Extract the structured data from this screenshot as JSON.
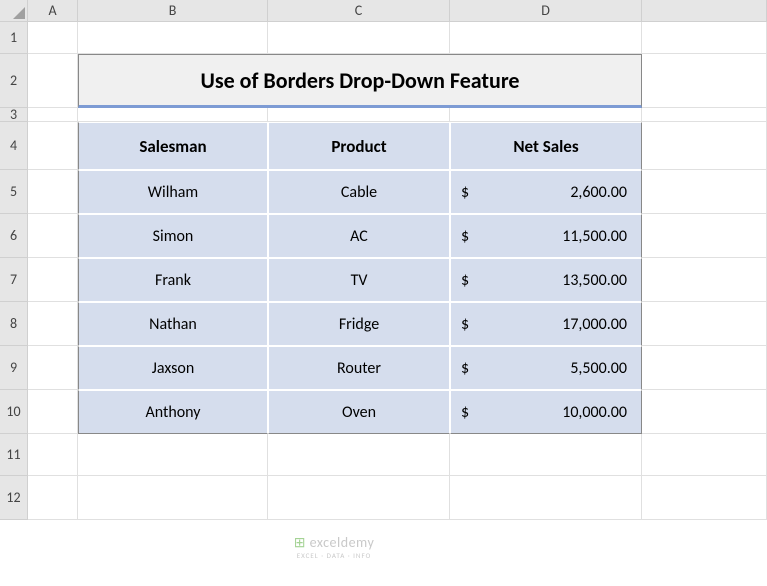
{
  "columns": [
    "A",
    "B",
    "C",
    "D",
    ""
  ],
  "rows": [
    "1",
    "2",
    "3",
    "4",
    "5",
    "6",
    "7",
    "8",
    "9",
    "10",
    "11",
    "12"
  ],
  "title": "Use of Borders Drop-Down Feature",
  "headers": {
    "salesman": "Salesman",
    "product": "Product",
    "netsales": "Net Sales"
  },
  "currency": "$",
  "data": [
    {
      "salesman": "Wilham",
      "product": "Cable",
      "netsales": "2,600.00"
    },
    {
      "salesman": "Simon",
      "product": "AC",
      "netsales": "11,500.00"
    },
    {
      "salesman": "Frank",
      "product": "TV",
      "netsales": "13,500.00"
    },
    {
      "salesman": "Nathan",
      "product": "Fridge",
      "netsales": "17,000.00"
    },
    {
      "salesman": "Jaxson",
      "product": "Router",
      "netsales": "5,500.00"
    },
    {
      "salesman": "Anthony",
      "product": "Oven",
      "netsales": "10,000.00"
    }
  ],
  "watermark": {
    "brand_main": "exceldemy",
    "brand_sub": "EXCEL · DATA · INFO"
  },
  "chart_data": {
    "type": "table",
    "title": "Use of Borders Drop-Down Feature",
    "columns": [
      "Salesman",
      "Product",
      "Net Sales"
    ],
    "rows": [
      [
        "Wilham",
        "Cable",
        2600.0
      ],
      [
        "Simon",
        "AC",
        11500.0
      ],
      [
        "Frank",
        "TV",
        13500.0
      ],
      [
        "Nathan",
        "Fridge",
        17000.0
      ],
      [
        "Jaxson",
        "Router",
        5500.0
      ],
      [
        "Anthony",
        "Oven",
        10000.0
      ]
    ]
  }
}
